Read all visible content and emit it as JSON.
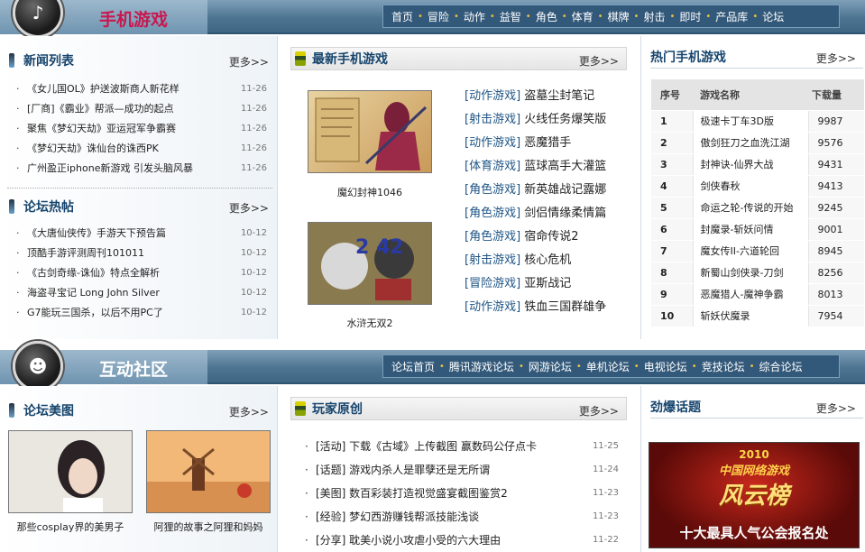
{
  "section1": {
    "title": "手机游戏",
    "nav": [
      "首页",
      "冒险",
      "动作",
      "益智",
      "角色",
      "体育",
      "棋牌",
      "射击",
      "即时",
      "产品库",
      "论坛"
    ],
    "news": {
      "title": "新闻列表",
      "more": "更多>>",
      "items": [
        {
          "text": "《女儿国OL》护送波斯商人新花样",
          "date": "11-26"
        },
        {
          "text": "[厂商]《霸业》帮派—成功的起点",
          "date": "11-26"
        },
        {
          "text": "聚焦《梦幻天劫》亚运冠军争霸赛",
          "date": "11-26"
        },
        {
          "text": "《梦幻天劫》诛仙台的诛西PK",
          "date": "11-26"
        },
        {
          "text": "广州盈正iphone新游戏 引发头脑风暴",
          "date": "11-26"
        }
      ]
    },
    "forum_hot": {
      "title": "论坛热帖",
      "more": "更多>>",
      "items": [
        {
          "text": "《大唐仙侠传》手游天下预告篇",
          "date": "10-12"
        },
        {
          "text": "顶酷手游评测周刊101011",
          "date": "10-12"
        },
        {
          "text": "《古剑奇缘-诛仙》特点全解析",
          "date": "10-12"
        },
        {
          "text": "海盗寻宝记 Long John Silver",
          "date": "10-12"
        },
        {
          "text": "G7能玩三国杀，以后不用PC了",
          "date": "10-12"
        }
      ]
    },
    "latest": {
      "title": "最新手机游戏",
      "more": "更多>>",
      "thumbs": [
        "魔幻封神1046",
        "水浒无双2"
      ],
      "games": [
        {
          "cat": "[动作游戏]",
          "name": "盗墓尘封笔记"
        },
        {
          "cat": "[射击游戏]",
          "name": "火线任务爆笑版"
        },
        {
          "cat": "[动作游戏]",
          "name": "恶魔猎手"
        },
        {
          "cat": "[体育游戏]",
          "name": "蓝球高手大灌篮"
        },
        {
          "cat": "[角色游戏]",
          "name": "新英雄战记露娜"
        },
        {
          "cat": "[角色游戏]",
          "name": "剑侣情缘柔情篇"
        },
        {
          "cat": "[角色游戏]",
          "name": "宿命传说2"
        },
        {
          "cat": "[射击游戏]",
          "name": "核心危机"
        },
        {
          "cat": "[冒险游戏]",
          "name": "亚斯战记"
        },
        {
          "cat": "[动作游戏]",
          "name": "铁血三国群雄争"
        }
      ]
    },
    "hot": {
      "title": "热门手机游戏",
      "more": "更多>>",
      "headers": [
        "序号",
        "游戏名称",
        "下载量"
      ],
      "rows": [
        [
          "1",
          "极速卡丁车3D版",
          "9987"
        ],
        [
          "2",
          "傲剑狂刀之血洗江湖",
          "9576"
        ],
        [
          "3",
          "封神诀-仙界大战",
          "9431"
        ],
        [
          "4",
          "剑侠春秋",
          "9413"
        ],
        [
          "5",
          "命运之轮-传说的开始",
          "9245"
        ],
        [
          "6",
          "封魔录-斩妖问情",
          "9001"
        ],
        [
          "7",
          "魔女传II-六道轮回",
          "8945"
        ],
        [
          "8",
          "新蜀山剑侠录-刀剑",
          "8256"
        ],
        [
          "9",
          "恶魔猎人-魔神争霸",
          "8013"
        ],
        [
          "10",
          "斩妖伏魔录",
          "7954"
        ]
      ]
    }
  },
  "section2": {
    "title": "互动社区",
    "nav": [
      "论坛首页",
      "腾讯游戏论坛",
      "网游论坛",
      "单机论坛",
      "电视论坛",
      "竞技论坛",
      "综合论坛"
    ],
    "gallery": {
      "title": "论坛美图",
      "more": "更多>>",
      "captions": [
        "那些cosplay界的美男子",
        "阿狸的故事之阿狸和妈妈"
      ]
    },
    "original": {
      "title": "玩家原创",
      "more": "更多>>",
      "items": [
        {
          "text": "[活动] 下载《古域》上传截图 赢数码公仔点卡",
          "date": "11-25"
        },
        {
          "text": "[话题] 游戏内杀人是罪孽还是无所谓",
          "date": "11-24"
        },
        {
          "text": "[美图] 数百彩装打造视觉盛宴截图鉴赏2",
          "date": "11-23"
        },
        {
          "text": "[经验] 梦幻西游赚钱帮派技能浅谈",
          "date": "11-23"
        },
        {
          "text": "[分享] 耽美小说小攻虐小受的六大理由",
          "date": "11-22"
        }
      ]
    },
    "hot_topic": {
      "title": "劲爆话题",
      "more": "更多>>",
      "banner_year": "2010",
      "banner_title": "中国网络游戏",
      "banner_big": "风云榜",
      "banner_caption": "十大最具人气公会报名处"
    }
  },
  "colors": {
    "accent": "#17456d",
    "band": "#4d7592",
    "nav_sep": "#f0c040",
    "link_cat": "#1f5585"
  }
}
